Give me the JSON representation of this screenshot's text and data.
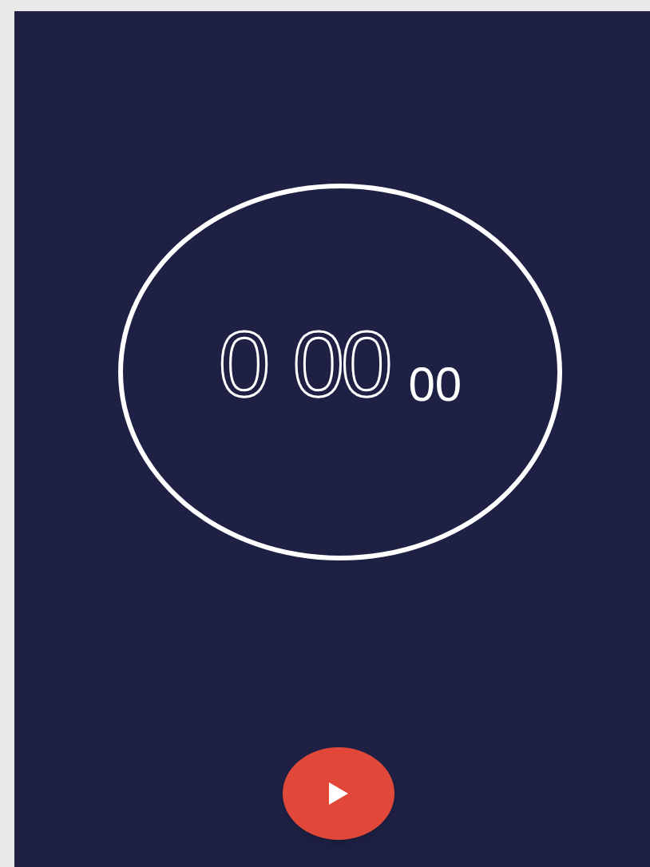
{
  "timer": {
    "minutes": "0",
    "seconds": "00",
    "hundredths": "00"
  }
}
